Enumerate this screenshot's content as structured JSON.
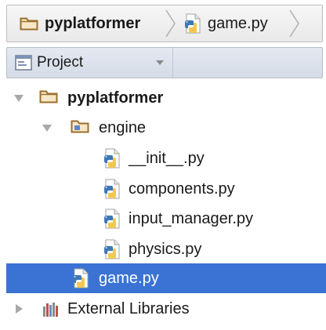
{
  "breadcrumb": {
    "items": [
      {
        "label": "pyplatformer",
        "icon": "folder-icon"
      },
      {
        "label": "game.py",
        "icon": "python-file-icon"
      }
    ]
  },
  "project_panel": {
    "view_selector": {
      "label": "Project",
      "icon": "project-view-icon"
    }
  },
  "tree": {
    "items": [
      {
        "label": "pyplatformer",
        "icon": "folder-icon",
        "expanded": true,
        "bold": true
      },
      {
        "label": "engine",
        "icon": "package-folder-icon",
        "expanded": true
      },
      {
        "label": "__init__.py",
        "icon": "python-file-icon"
      },
      {
        "label": "components.py",
        "icon": "python-file-icon"
      },
      {
        "label": "input_manager.py",
        "icon": "python-file-icon"
      },
      {
        "label": "physics.py",
        "icon": "python-file-icon"
      },
      {
        "label": "game.py",
        "icon": "python-file-icon",
        "selected": true
      },
      {
        "label": "External Libraries",
        "icon": "libraries-icon",
        "expanded": false
      }
    ]
  },
  "colors": {
    "selection": "#3b73d4",
    "folder": "#b58a4a",
    "python_blue": "#3f78b5",
    "python_yellow": "#f2c94c"
  }
}
